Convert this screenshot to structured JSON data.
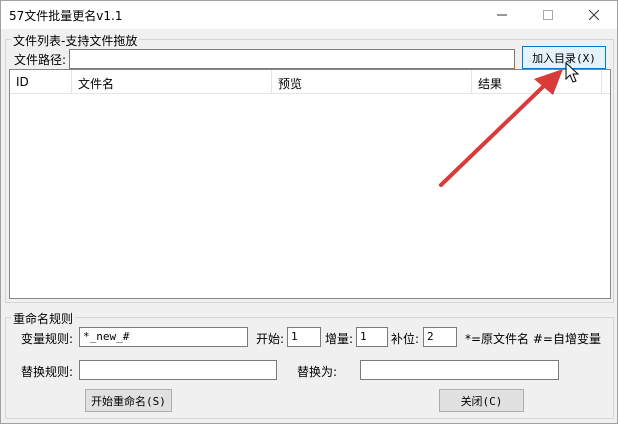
{
  "window": {
    "title": "57文件批量更名v1.1",
    "minimize_icon": "minimize-icon",
    "maximize_icon": "maximize-icon",
    "close_icon": "close-icon"
  },
  "file_list": {
    "group_label": "文件列表-支持文件拖放",
    "path_label": "文件路径:",
    "path_value": "",
    "add_dir_button": "加入目录(X)",
    "columns": [
      "ID",
      "文件名",
      "预览",
      "结果"
    ]
  },
  "rename_rules": {
    "group_label": "重命名规则",
    "var_rule_label": "变量规则:",
    "var_rule_value": "*_new_#",
    "start_label": "开始:",
    "start_value": "1",
    "increment_label": "增量:",
    "increment_value": "1",
    "pad_label": "补位:",
    "pad_value": "2",
    "hint": "*=原文件名 #=自增变量",
    "replace_rule_label": "替换规则:",
    "replace_rule_value": "",
    "replace_with_label": "替换为:",
    "replace_with_value": "",
    "start_button": "开始重命名(S)",
    "close_button": "关闭(C)"
  },
  "colors": {
    "accent": "#0078d7",
    "arrow": "#d93a3a"
  }
}
